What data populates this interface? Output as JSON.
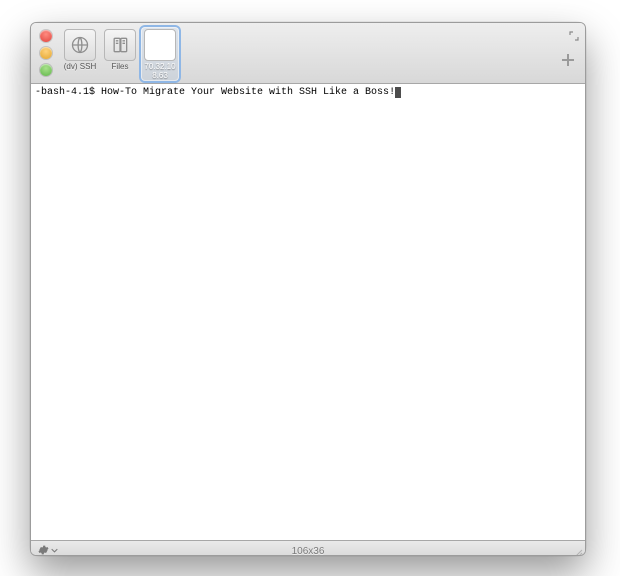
{
  "tabs": [
    {
      "label": "(dv) SSH"
    },
    {
      "label": "Files"
    },
    {
      "label_line1": "70.32.10",
      "label_line2": "8.63"
    }
  ],
  "terminal": {
    "prompt": "-bash-4.1$ ",
    "command": "How-To Migrate Your Website with SSH Like a Boss!"
  },
  "status": {
    "dimensions": "106x36"
  }
}
